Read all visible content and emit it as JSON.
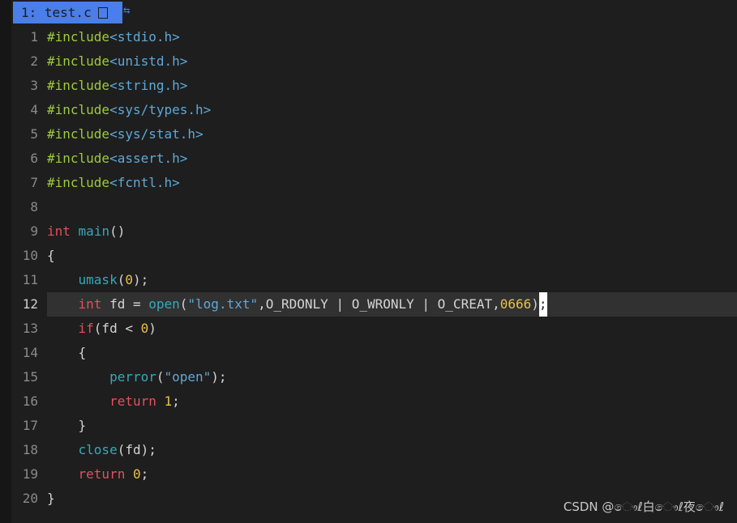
{
  "tab": {
    "label": "1: test.c",
    "swap_glyph": "⇆"
  },
  "colors": {
    "background": "#1e1e1e",
    "tab": "#4a7ee8",
    "preprocessor": "#9ecb3c",
    "keyword": "#e2505e",
    "function": "#38a8b8",
    "string": "#5fa8d6",
    "number": "#e8c24a",
    "cursorline": "#313131"
  },
  "current_line": 12,
  "lines": [
    {
      "n": "1",
      "tokens": [
        {
          "t": "#include",
          "c": "pp"
        },
        {
          "t": "<stdio.h>",
          "c": "hdr"
        }
      ]
    },
    {
      "n": "2",
      "tokens": [
        {
          "t": "#include",
          "c": "pp"
        },
        {
          "t": "<unistd.h>",
          "c": "hdr"
        }
      ]
    },
    {
      "n": "3",
      "tokens": [
        {
          "t": "#include",
          "c": "pp"
        },
        {
          "t": "<string.h>",
          "c": "hdr"
        }
      ]
    },
    {
      "n": "4",
      "tokens": [
        {
          "t": "#include",
          "c": "pp"
        },
        {
          "t": "<sys/types.h>",
          "c": "hdr"
        }
      ]
    },
    {
      "n": "5",
      "tokens": [
        {
          "t": "#include",
          "c": "pp"
        },
        {
          "t": "<sys/stat.h>",
          "c": "hdr"
        }
      ]
    },
    {
      "n": "6",
      "tokens": [
        {
          "t": "#include",
          "c": "pp"
        },
        {
          "t": "<assert.h>",
          "c": "hdr"
        }
      ]
    },
    {
      "n": "7",
      "tokens": [
        {
          "t": "#include",
          "c": "pp"
        },
        {
          "t": "<fcntl.h>",
          "c": "hdr"
        }
      ]
    },
    {
      "n": "8",
      "tokens": []
    },
    {
      "n": "9",
      "tokens": [
        {
          "t": "int",
          "c": "kw"
        },
        {
          "t": " "
        },
        {
          "t": "main",
          "c": "fn"
        },
        {
          "t": "()"
        }
      ]
    },
    {
      "n": "10",
      "tokens": [
        {
          "t": "{"
        }
      ]
    },
    {
      "n": "11",
      "tokens": [
        {
          "t": "    "
        },
        {
          "t": "umask",
          "c": "fn"
        },
        {
          "t": "("
        },
        {
          "t": "0",
          "c": "num"
        },
        {
          "t": ");"
        }
      ]
    },
    {
      "n": "12",
      "tokens": [
        {
          "t": "    "
        },
        {
          "t": "int",
          "c": "kw"
        },
        {
          "t": " fd = "
        },
        {
          "t": "open",
          "c": "fn"
        },
        {
          "t": "("
        },
        {
          "t": "\"log.txt\"",
          "c": "str"
        },
        {
          "t": ",O_RDONLY | O_WRONLY | O_CREAT,"
        },
        {
          "t": "0666",
          "c": "num"
        },
        {
          "t": ")"
        },
        {
          "t": ";",
          "c": "cursor"
        }
      ]
    },
    {
      "n": "13",
      "tokens": [
        {
          "t": "    "
        },
        {
          "t": "if",
          "c": "kw"
        },
        {
          "t": "(fd < "
        },
        {
          "t": "0",
          "c": "num"
        },
        {
          "t": ")"
        }
      ]
    },
    {
      "n": "14",
      "tokens": [
        {
          "t": "    {"
        }
      ]
    },
    {
      "n": "15",
      "tokens": [
        {
          "t": "        "
        },
        {
          "t": "perror",
          "c": "fn"
        },
        {
          "t": "("
        },
        {
          "t": "\"open\"",
          "c": "str"
        },
        {
          "t": ");"
        }
      ]
    },
    {
      "n": "16",
      "tokens": [
        {
          "t": "        "
        },
        {
          "t": "return",
          "c": "kw"
        },
        {
          "t": " "
        },
        {
          "t": "1",
          "c": "num"
        },
        {
          "t": ";"
        }
      ]
    },
    {
      "n": "17",
      "tokens": [
        {
          "t": "    }"
        }
      ]
    },
    {
      "n": "18",
      "tokens": [
        {
          "t": "    "
        },
        {
          "t": "close",
          "c": "fn"
        },
        {
          "t": "(fd);"
        }
      ]
    },
    {
      "n": "19",
      "tokens": [
        {
          "t": "    "
        },
        {
          "t": "return",
          "c": "kw"
        },
        {
          "t": " "
        },
        {
          "t": "0",
          "c": "num"
        },
        {
          "t": ";"
        }
      ]
    },
    {
      "n": "20",
      "tokens": [
        {
          "t": "}"
        }
      ]
    }
  ],
  "watermark": "CSDN @ෞℓ白ෞℓ夜ෞℓ"
}
